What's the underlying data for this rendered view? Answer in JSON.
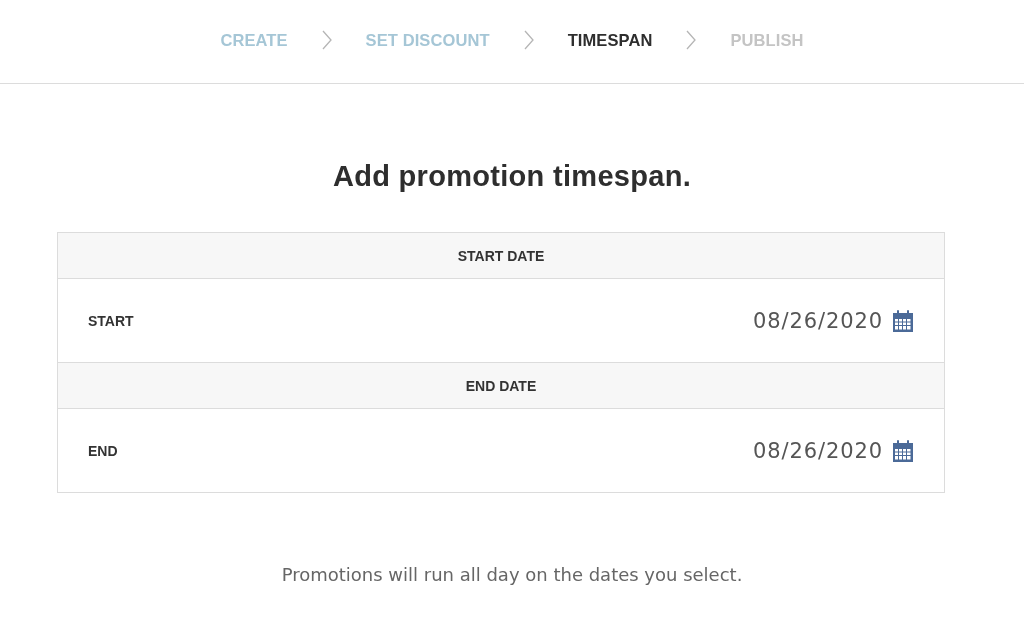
{
  "steps": [
    {
      "label": "CREATE",
      "completed": true,
      "selected": false
    },
    {
      "label": "SET DISCOUNT",
      "completed": true,
      "selected": false
    },
    {
      "label": "TIMESPAN",
      "completed": false,
      "selected": true
    },
    {
      "label": "PUBLISH",
      "completed": false,
      "selected": false
    }
  ],
  "heading": "Add promotion timespan.",
  "sections": [
    {
      "title": "START DATE",
      "label": "START",
      "value": "08/26/2020"
    },
    {
      "title": "END DATE",
      "label": "END",
      "value": "08/26/2020"
    }
  ],
  "note": "Promotions will run all day on the dates you select."
}
